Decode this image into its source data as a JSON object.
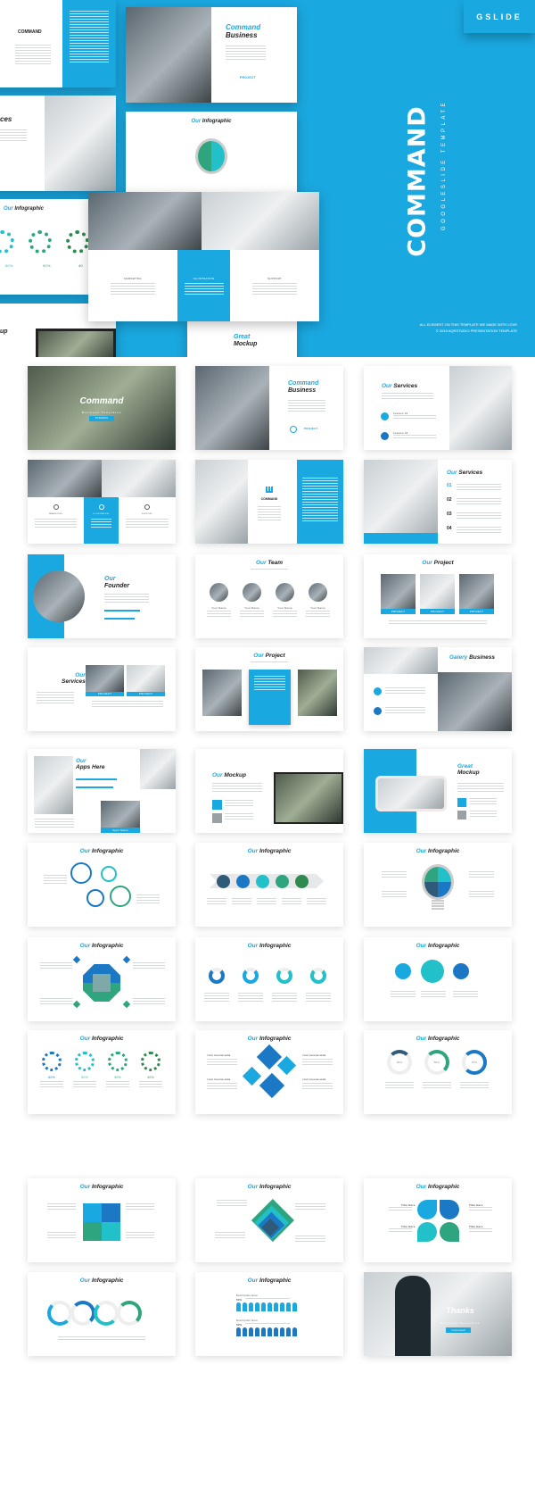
{
  "colors": {
    "accent": "#1aa8e0",
    "dark_blue": "#1b78c4",
    "teal": "#22c1c9",
    "green": "#2ea57e",
    "dark_green": "#2e8a4f",
    "navy": "#2f5a78"
  },
  "hero": {
    "badge": "GSLIDE",
    "title": "COMMAND",
    "subtitle": "GOOGLESLIDE TEMPLATE",
    "footer_line1": "ALL ELEMENT ON THIS TEMPLATE WE MADE WITH LOVE",
    "footer_line2": "© 2019 AQRSTUDIO PRESENTATION TEMPLATE",
    "collage": {
      "logo": "COMMAND",
      "business_title_a": "Command",
      "business_title_b": "Business",
      "project_label": "PROJECT",
      "services_title_b": "ces",
      "infographic_a": "Our",
      "infographic_b": "Infographic",
      "percents": [
        "50%",
        "90%",
        "40"
      ],
      "cols": [
        "MARKETING",
        "ILLUSTRATION",
        "SUPPORT"
      ],
      "mockup_a": "Great",
      "mockup_b": "Mockup",
      "mockup_left": "up"
    }
  },
  "slides": [
    {
      "kind": "cover",
      "title": "Command",
      "sub": "Business Templates",
      "button": "BUSINESS"
    },
    {
      "kind": "photo-left",
      "ta": "Command",
      "tb": "Business",
      "label": "PROJECT"
    },
    {
      "kind": "photo-right",
      "ta": "Our",
      "tb": "Services",
      "items": [
        "Feature 01",
        "Feature 02"
      ]
    },
    {
      "kind": "three-cols",
      "cols": [
        "MARKETING",
        "ILLUSTRATION",
        "SUPPORT"
      ]
    },
    {
      "kind": "logo-blue",
      "logo": "COMMAND"
    },
    {
      "kind": "numbered",
      "ta": "Our",
      "tb": "Services",
      "nums": [
        "01",
        "02",
        "03",
        "04"
      ]
    },
    {
      "kind": "founder",
      "ta": "Our",
      "tb": "Founder"
    },
    {
      "kind": "team",
      "ta": "Our",
      "tb": "Team",
      "names": [
        "Your Name",
        "Your Name",
        "Your Name",
        "Your Name"
      ]
    },
    {
      "kind": "project3",
      "ta": "Our",
      "tb": "Project",
      "labels": [
        "PROJECT",
        "PROJECT",
        "PROJECT"
      ]
    },
    {
      "kind": "services2",
      "ta": "Our",
      "tb": "Services",
      "labels": [
        "PROJECT",
        "PROJECT"
      ]
    },
    {
      "kind": "project-mid",
      "ta": "Our",
      "tb": "Project"
    },
    {
      "kind": "galery",
      "ta": "Galery",
      "tb": "Business"
    },
    {
      "kind": "apps",
      "ta": "Our",
      "tb": "Apps Here",
      "button": "Apps Name"
    },
    {
      "kind": "mockup",
      "ta": "Our",
      "tb": "Mockup"
    },
    {
      "kind": "great-mockup",
      "ta": "Great",
      "tb": "Mockup"
    },
    {
      "kind": "info-circles",
      "ta": "Our",
      "tb": "Infographic"
    },
    {
      "kind": "info-arrow",
      "ta": "Our",
      "tb": "Infographic"
    },
    {
      "kind": "info-bulb",
      "ta": "Our",
      "tb": "Infographic"
    },
    {
      "kind": "info-octa",
      "ta": "Our",
      "tb": "Infographic"
    },
    {
      "kind": "info-rings",
      "ta": "Our",
      "tb": "Infographic"
    },
    {
      "kind": "info-icons",
      "ta": "Our",
      "tb": "Infographic"
    },
    {
      "kind": "info-percent",
      "ta": "Our",
      "tb": "Infographic",
      "values": [
        "60%",
        "50%",
        "90%",
        "40%"
      ]
    },
    {
      "kind": "info-diamonds",
      "ta": "Our",
      "tb": "Infographic",
      "tagline": "YOUR TAGLINE HERE"
    },
    {
      "kind": "info-donuts",
      "ta": "Our",
      "tb": "Infographic",
      "values": [
        "25%",
        "50%",
        "75%"
      ]
    },
    {
      "kind": "info-puzzle",
      "ta": "Our",
      "tb": "Infographic"
    },
    {
      "kind": "info-pyramid",
      "ta": "Our",
      "tb": "Infographic"
    },
    {
      "kind": "info-petals",
      "ta": "Our",
      "tb": "Infographic",
      "labels": [
        "Title Here",
        "Title Here",
        "Title Here",
        "Title Here"
      ]
    },
    {
      "kind": "info-wave",
      "ta": "Our",
      "tb": "Infographic"
    },
    {
      "kind": "info-people",
      "ta": "Our",
      "tb": "Infographic",
      "desc": "Description Here",
      "value": "50%"
    },
    {
      "kind": "thanks",
      "title": "Thanks",
      "sub": "Business Templates",
      "button": "Command"
    }
  ]
}
